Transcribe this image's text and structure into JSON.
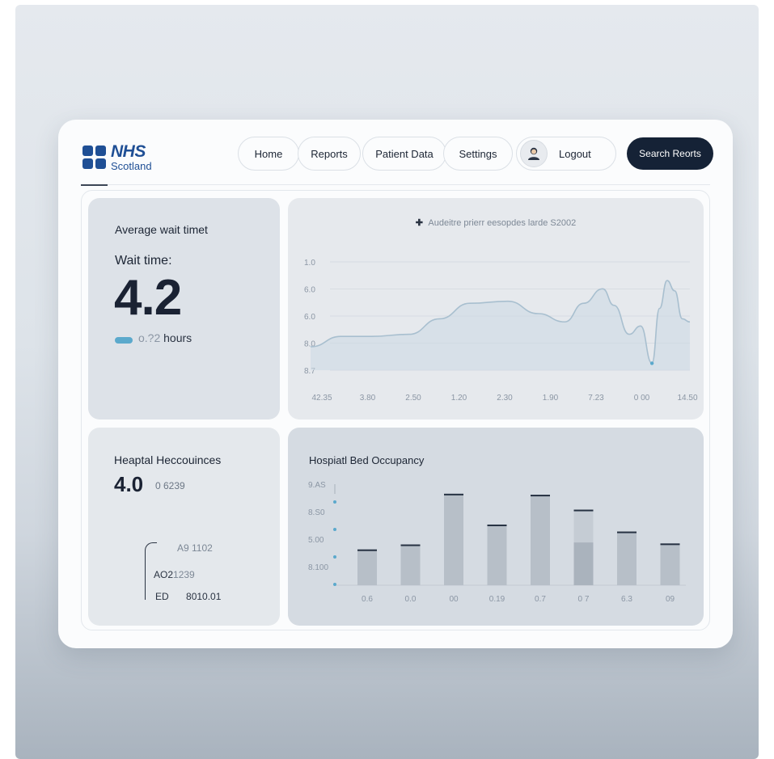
{
  "brand": {
    "name": "NHS",
    "region": "Scotland",
    "color": "#1f4f95"
  },
  "nav": {
    "home": "Home",
    "reports": "Reports",
    "patient_data": "Patient Data",
    "settings": "Settings",
    "logout": "Logout",
    "user_icon": "user-avatar-icon"
  },
  "search_button": "Search Reorts",
  "wait_card": {
    "title": "Average wait timet",
    "label": "Wait time:",
    "value": "4.2",
    "sub_value": "o.?2",
    "unit": "hours",
    "indicator_color": "#5ba9cc"
  },
  "line_card": {
    "legend_marker": "✚",
    "title": "Audeitre prierr eesopdes larde S2002"
  },
  "hospital_card": {
    "title": "Heaptal Heccouinces",
    "value": "4.0",
    "value_sub": "0 6239",
    "stat1": "A9 1102",
    "stat2_label": "AO2",
    "stat2_value": "1239",
    "stat3_label": "ED",
    "stat3_value": "8010.01"
  },
  "bar_card": {
    "title": "Hospiatl Bed Occupancy"
  },
  "chart_data": [
    {
      "type": "line",
      "title": "Audeitre prierr eesopdes larde S2002",
      "y_tick_labels": [
        "1.0",
        "6.0",
        "6.0",
        "8.0",
        "8.7"
      ],
      "x_tick_labels": [
        "42.35",
        "3.80",
        "2.50",
        "1.20",
        "2.30",
        "1.90",
        "7.23",
        "0 00",
        "14.50"
      ],
      "series": [
        {
          "x": [
            0,
            0.08,
            0.16,
            0.26,
            0.34,
            0.42,
            0.52,
            0.6,
            0.67,
            0.72,
            0.77,
            0.8,
            0.84,
            0.87,
            0.9,
            0.92,
            0.94,
            0.96,
            0.98,
            1.0
          ],
          "values": [
            0.18,
            0.28,
            0.28,
            0.3,
            0.45,
            0.6,
            0.62,
            0.5,
            0.42,
            0.6,
            0.74,
            0.58,
            0.3,
            0.38,
            0.02,
            0.55,
            0.82,
            0.72,
            0.45,
            0.42
          ]
        }
      ]
    },
    {
      "type": "bar",
      "title": "Hospiatl Bed Occupancy",
      "y_tick_labels": [
        "9.AS",
        "8.S0",
        "5.00",
        "8.100"
      ],
      "categories": [
        "0.6",
        "0.0",
        "00",
        "0.19",
        "0.7",
        "0 7",
        "6.3",
        "09"
      ],
      "values": [
        36,
        41,
        92,
        61,
        91,
        76,
        54,
        42
      ],
      "overlay_values": [
        0,
        0,
        0,
        0,
        0,
        43,
        0,
        0
      ],
      "ylim": [
        0,
        100
      ]
    }
  ],
  "colors": {
    "accent_dark": "#152236",
    "line_stroke": "#a8bfcf",
    "line_fill": "#cbd9e3",
    "bar_fill": "#b7bfc8",
    "bar_cap": "#263142",
    "tick_dot": "#5ba9cc"
  }
}
